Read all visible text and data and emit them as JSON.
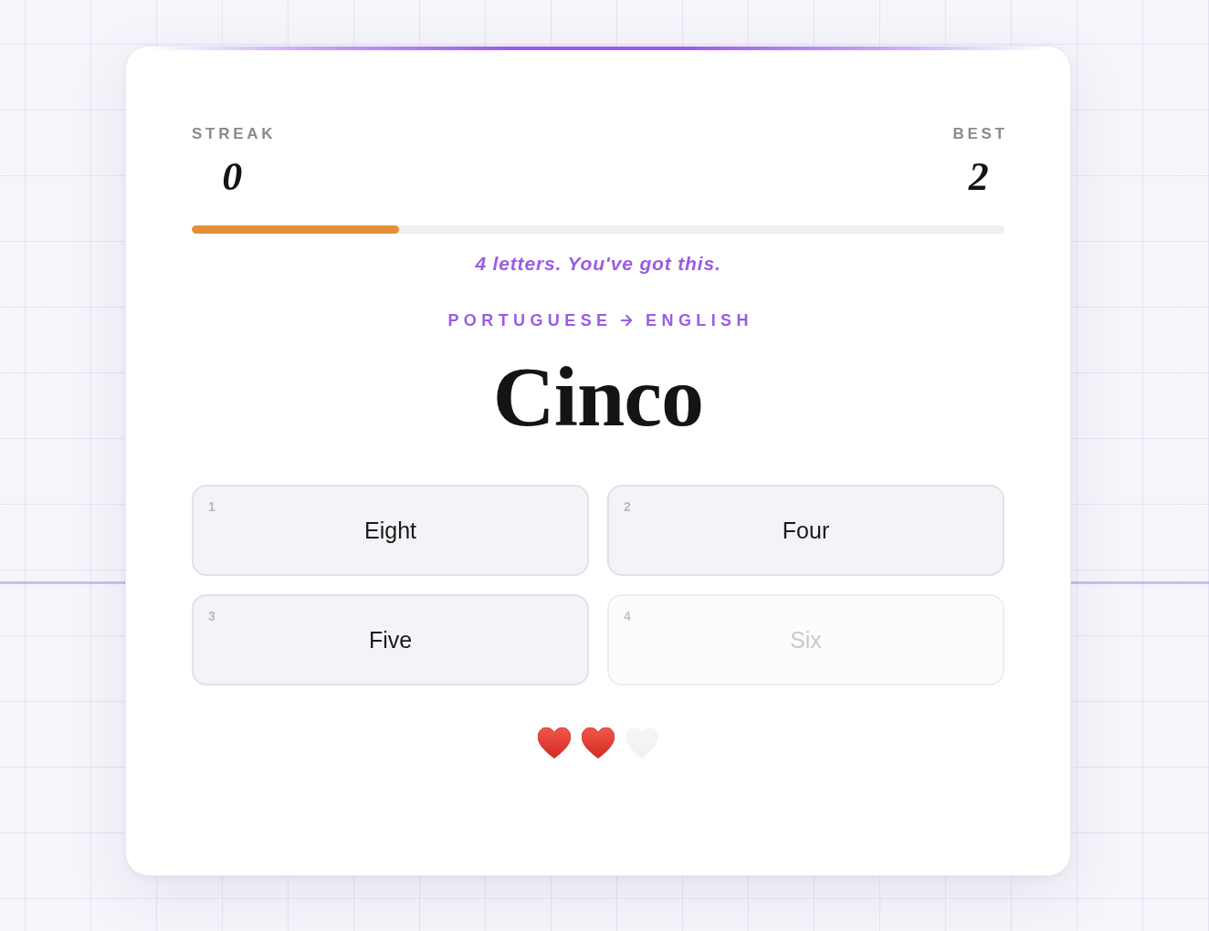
{
  "stats": [
    {
      "label": "STREAK",
      "value": "0"
    },
    {
      "label": "BEST",
      "value": "2"
    }
  ],
  "progress": {
    "level": 0.255
  },
  "hint": "4 letters. You've got this.",
  "direction": {
    "from": "PORTUGUESE",
    "to": "ENGLISH"
  },
  "word": "Cinco",
  "options": [
    {
      "number": "1",
      "label": "Eight",
      "disabled": false
    },
    {
      "number": "2",
      "label": "Four",
      "disabled": false
    },
    {
      "number": "3",
      "label": "Five",
      "disabled": false
    },
    {
      "number": "4",
      "label": "Six",
      "disabled": true
    }
  ],
  "lives": [
    {
      "filled": true
    },
    {
      "filled": true
    },
    {
      "filled": false
    }
  ]
}
